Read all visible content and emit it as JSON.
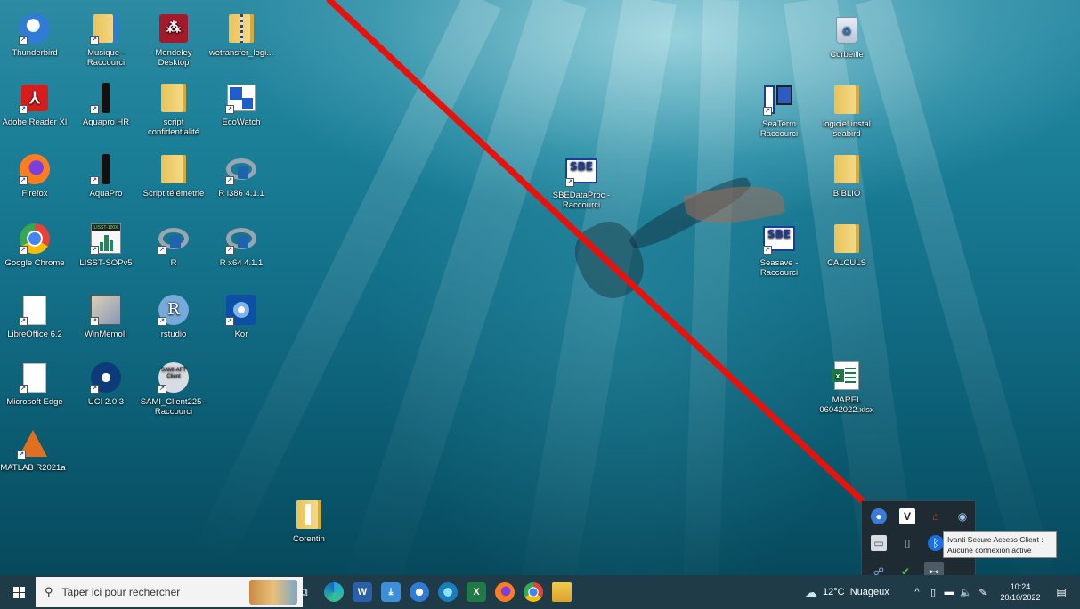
{
  "desktop": {
    "icons": [
      {
        "label": "Thunderbird"
      },
      {
        "label": "Musique -\nRaccourci"
      },
      {
        "label": "Mendeley\nDesktop"
      },
      {
        "label": "wetransfer_logi..."
      },
      {
        "label": "Adobe Reader XI"
      },
      {
        "label": "Aquapro HR"
      },
      {
        "label": "script\nconfidentialité"
      },
      {
        "label": "EcoWatch"
      },
      {
        "label": "Firefox"
      },
      {
        "label": "AquaPro"
      },
      {
        "label": "Script télémétrie"
      },
      {
        "label": "R i386 4.1.1"
      },
      {
        "label": "Google Chrome"
      },
      {
        "label": "LISST-SOPv5"
      },
      {
        "label": "R"
      },
      {
        "label": "R x64 4.1.1"
      },
      {
        "label": "LibreOffice 6.2"
      },
      {
        "label": "WinMemoII"
      },
      {
        "label": "rstudio"
      },
      {
        "label": "Kor"
      },
      {
        "label": "Microsoft Edge"
      },
      {
        "label": "UCI 2.0.3"
      },
      {
        "label": "SAMI_Client225 -\nRaccourci"
      },
      {
        "label": "MATLAB R2021a"
      },
      {
        "label": "Corentin"
      },
      {
        "label": "SBEDataProc -\nRaccourci"
      },
      {
        "label": "SeaTerm\nRaccourci"
      },
      {
        "label": "logiciel instal\nseabird"
      },
      {
        "label": "Corbeille"
      },
      {
        "label": "BIBLIO"
      },
      {
        "label": "Seasave -\nRaccourci"
      },
      {
        "label": "CALCULS"
      },
      {
        "label": "MAREL\n06042022.xlsx"
      }
    ],
    "icon_glyphs": {
      "sbe": "SBE",
      "lisst": "LISST-100X",
      "rstudio": "R",
      "sami": "SAMI-AFT\nClient",
      "excel": "x"
    }
  },
  "tray_popup": {
    "tooltip_line1": "Ivanti Secure Access Client :",
    "tooltip_line2": "Aucune connexion active"
  },
  "taskbar": {
    "search_placeholder": "Taper ici pour rechercher",
    "weather": "12°C  Nuageux",
    "time": "10:24",
    "date": "20/10/2022",
    "app_glyphs": {
      "word": "W",
      "excel": "X"
    }
  },
  "colors": {
    "arrow": "#e8120c",
    "taskbar": "#1f3b48",
    "tray_popup": "#1f2b32"
  }
}
